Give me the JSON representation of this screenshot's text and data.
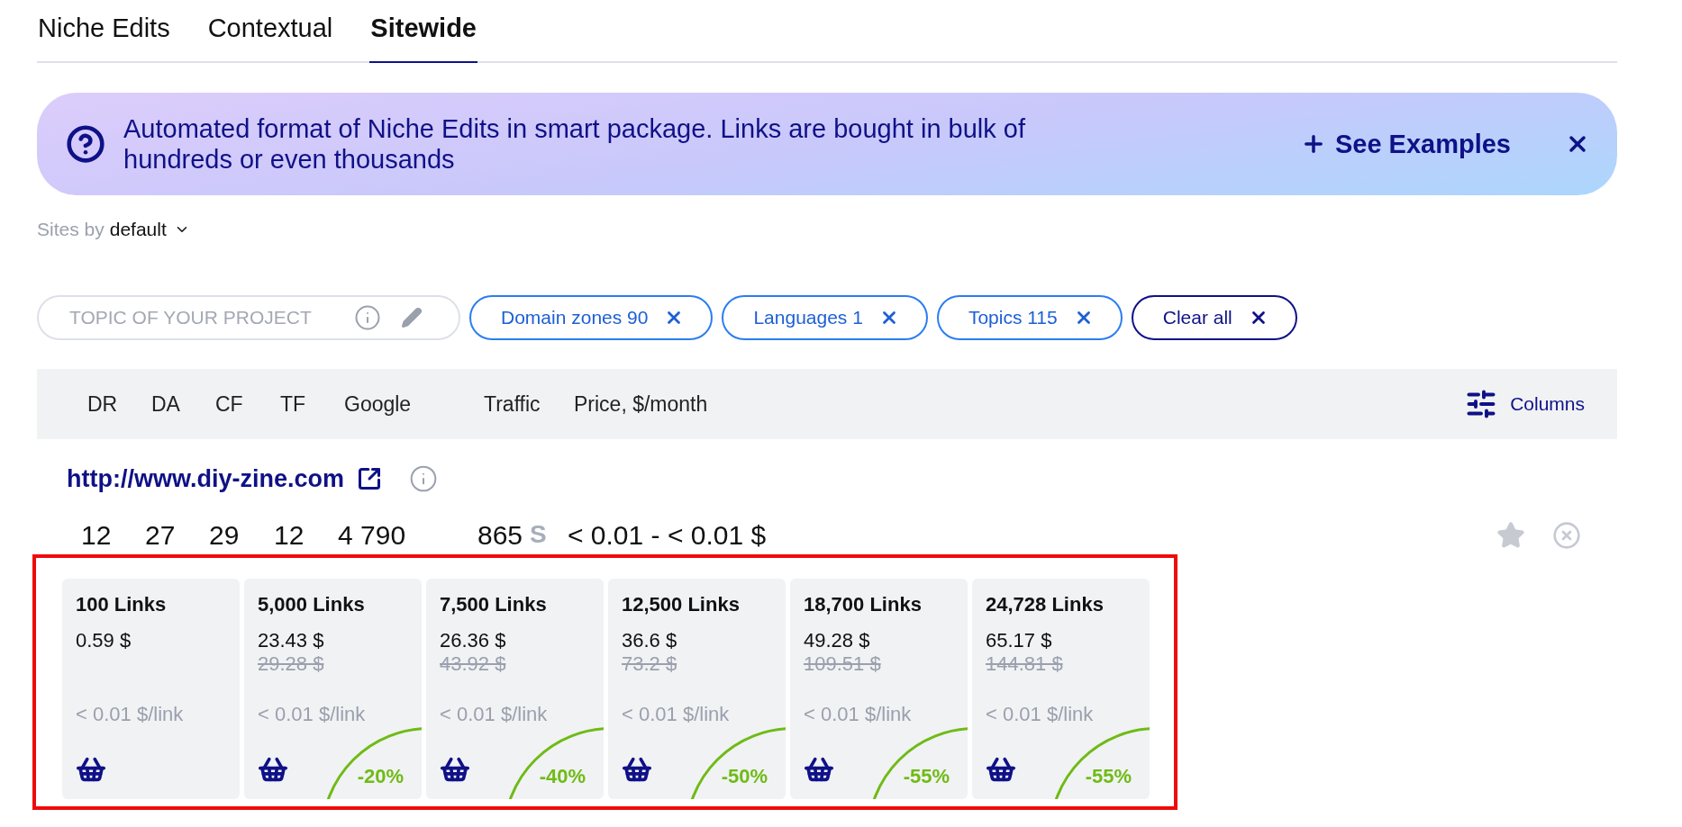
{
  "tabs": [
    {
      "label": "Niche Edits",
      "selected": false
    },
    {
      "label": "Contextual",
      "selected": false
    },
    {
      "label": "Sitewide",
      "selected": true
    }
  ],
  "banner": {
    "text": "Automated format of Niche Edits in smart package. Links are bought in bulk of hundreds or even thousands",
    "action": "See Examples"
  },
  "sort": {
    "prefix": "Sites by",
    "value": "default"
  },
  "topic_field": {
    "placeholder": "TOPIC OF YOUR PROJECT"
  },
  "filters": [
    {
      "label": "Domain zones 90",
      "kind": "filter"
    },
    {
      "label": "Languages 1",
      "kind": "filter"
    },
    {
      "label": "Topics 115",
      "kind": "filter"
    },
    {
      "label": "Clear all",
      "kind": "clear"
    }
  ],
  "table": {
    "columns": [
      "DR",
      "DA",
      "CF",
      "TF",
      "Google",
      "Traffic",
      "Price, $/month"
    ],
    "columns_button": "Columns"
  },
  "site": {
    "url": "http://www.diy-zine.com",
    "values": [
      "12",
      "27",
      "29",
      "12",
      "4 790",
      "865",
      "< 0.01 - < 0.01 $"
    ],
    "traffic_mark": "S"
  },
  "packages": [
    {
      "links": "100 Links",
      "price": "0.59 $",
      "per_link": "< 0.01 $/link"
    },
    {
      "links": "5,000 Links",
      "price": "23.43 $",
      "old_price": "29.28 $",
      "per_link": "< 0.01 $/link",
      "discount": "-20%"
    },
    {
      "links": "7,500 Links",
      "price": "26.36 $",
      "old_price": "43.92 $",
      "per_link": "< 0.01 $/link",
      "discount": "-40%"
    },
    {
      "links": "12,500 Links",
      "price": "36.6 $",
      "old_price": "73.2 $",
      "per_link": "< 0.01 $/link",
      "discount": "-50%"
    },
    {
      "links": "18,700 Links",
      "price": "49.28 $",
      "old_price": "109.51 $",
      "per_link": "< 0.01 $/link",
      "discount": "-55%"
    },
    {
      "links": "24,728 Links",
      "price": "65.17 $",
      "old_price": "144.81 $",
      "per_link": "< 0.01 $/link",
      "discount": "-55%"
    }
  ]
}
